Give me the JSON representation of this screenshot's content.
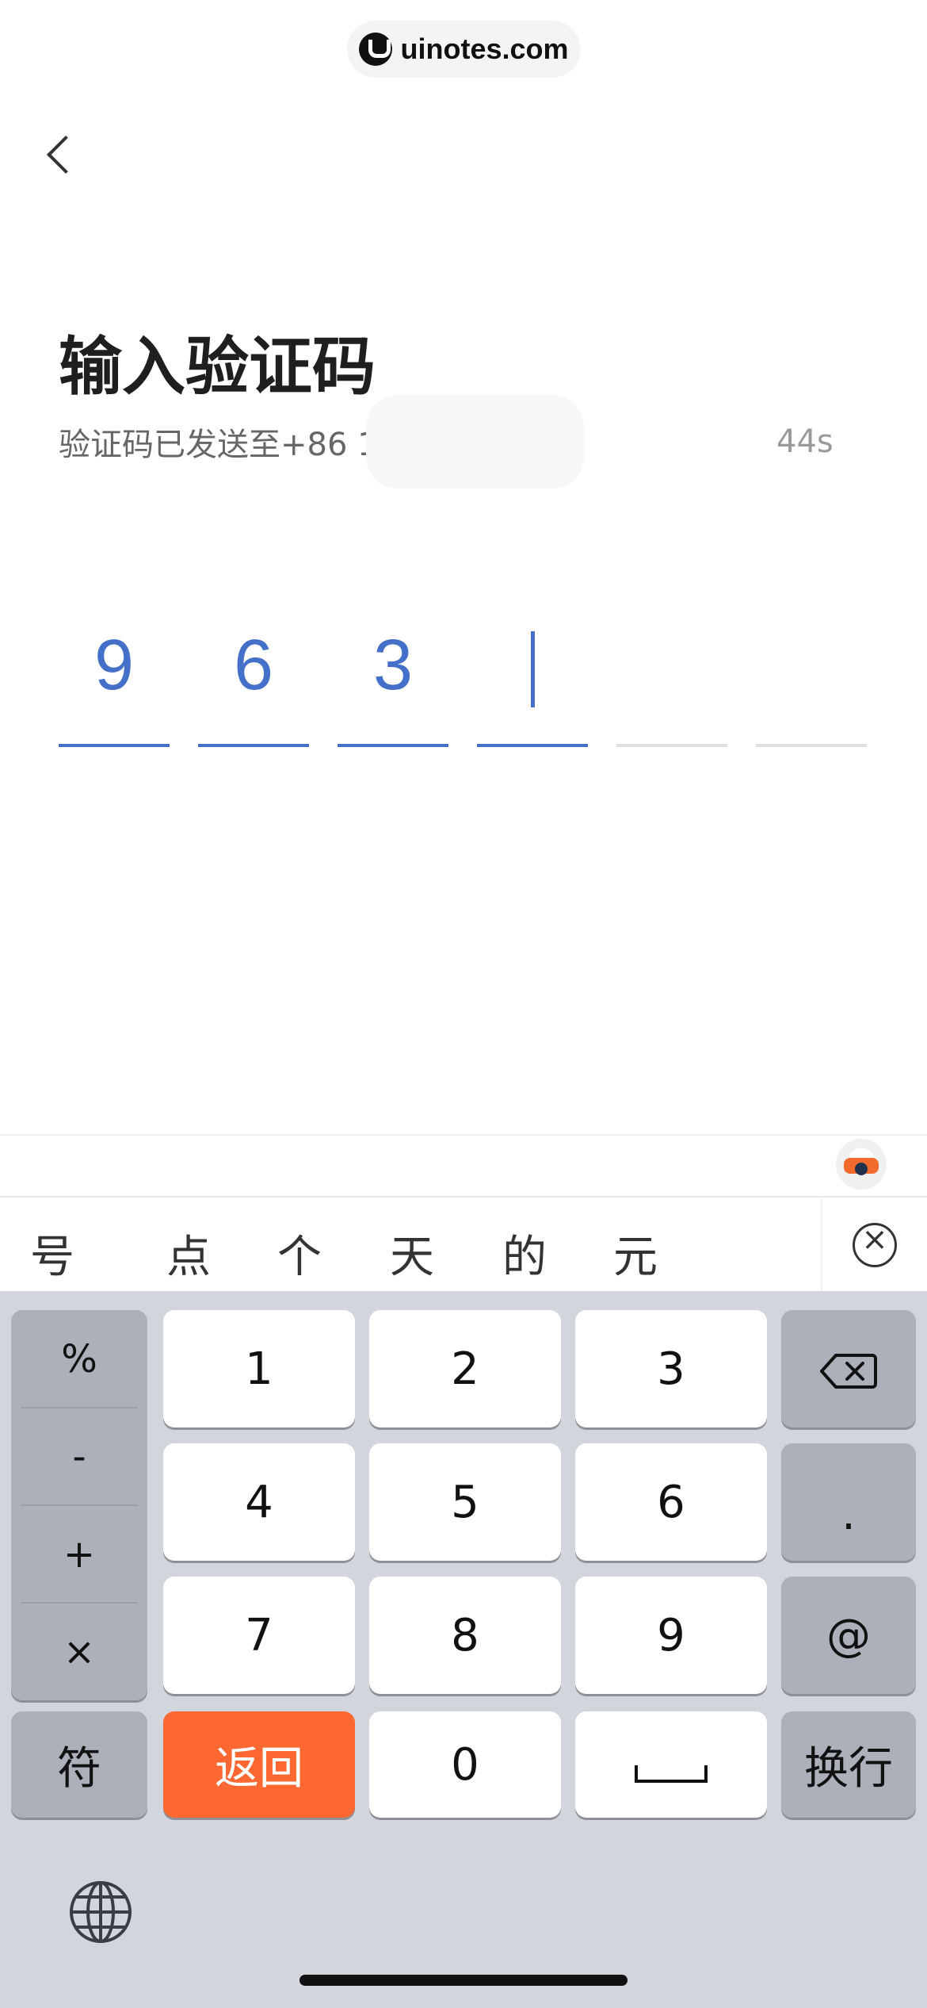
{
  "watermark": {
    "text": "uinotes.com"
  },
  "header": {
    "title": "输入验证码",
    "subtitle": "验证码已发送至+86 1",
    "countdown": "44s"
  },
  "code": {
    "digits": [
      "9",
      "6",
      "3",
      "",
      "",
      ""
    ],
    "active_index": 3
  },
  "candidates": [
    "号",
    "点",
    "个",
    "天",
    "的",
    "元"
  ],
  "keyboard": {
    "symbols": [
      "%",
      "-",
      "+",
      "×"
    ],
    "digits": [
      "1",
      "2",
      "3",
      "4",
      "5",
      "6",
      "7",
      "8",
      "9",
      "0"
    ],
    "dot": ".",
    "at": "@",
    "symbol_key": "符",
    "return_key": "返回",
    "newline_key": "换行"
  },
  "colors": {
    "accent": "#4470c9",
    "orange": "#fd6732",
    "keyboard_bg": "#d2d5db",
    "key_gray": "#acb0ba"
  }
}
